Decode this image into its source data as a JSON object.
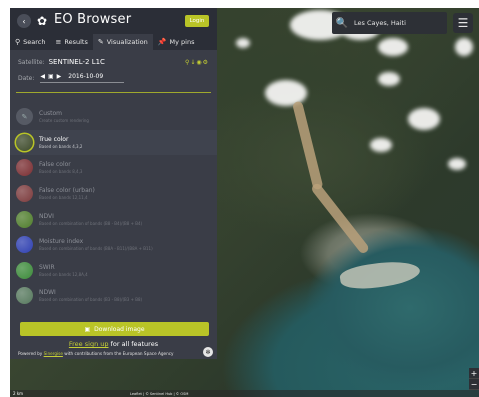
{
  "app": {
    "title": "EO Browser",
    "login_label": "Login"
  },
  "tabs": [
    {
      "label": "Search",
      "icon": "search-icon"
    },
    {
      "label": "Results",
      "icon": "list-icon"
    },
    {
      "label": "Visualization",
      "icon": "brush-icon"
    },
    {
      "label": "My pins",
      "icon": "pin-icon"
    }
  ],
  "satellite": {
    "label": "Satellite:",
    "value": "SENTINEL-2 L1C"
  },
  "date": {
    "label": "Date:",
    "value": "2016-10-09"
  },
  "layers": [
    {
      "name": "Custom",
      "desc": "Create custom rendering",
      "active": false,
      "color": "#5a5d66"
    },
    {
      "name": "True color",
      "desc": "Based on bands 4,3,2",
      "active": true,
      "color": "#3d4a2a"
    },
    {
      "name": "False color",
      "desc": "Based on bands 8,4,3",
      "active": false,
      "color": "#7a2e32"
    },
    {
      "name": "False color (urban)",
      "desc": "Based on bands 12,11,4",
      "active": false,
      "color": "#7b3a3c"
    },
    {
      "name": "NDVI",
      "desc": "Based on combination of bands (B8 - B4)/(B8 + B4)",
      "active": false,
      "color": "#4f7d2c"
    },
    {
      "name": "Moisture index",
      "desc": "Based on combination of bands (B8A - B11)/(B8A + B11)",
      "active": false,
      "color": "#2e3fb0"
    },
    {
      "name": "SWIR",
      "desc": "Based on bands 12,8A,4",
      "active": false,
      "color": "#3c8a3a"
    },
    {
      "name": "NDWI",
      "desc": "Based on combination of bands (B3 - B8)/(B3 + B8)",
      "active": false,
      "color": "#56785d"
    }
  ],
  "download_label": "Download image",
  "signup": {
    "link": "Free sign up",
    "rest": "for all features"
  },
  "powered": {
    "prefix": "Powered by",
    "link": "Sinergise",
    "rest": "with contributions from the European Space Agency"
  },
  "search": {
    "value": "Les Cayes, Haiti"
  },
  "attribution": {
    "scale": "2 km",
    "text": "Leaflet | © Sentinel Hub | © OSM"
  },
  "colors": {
    "accent": "#b9c427",
    "panel": "#3a3d47",
    "header": "#2b2e37"
  }
}
